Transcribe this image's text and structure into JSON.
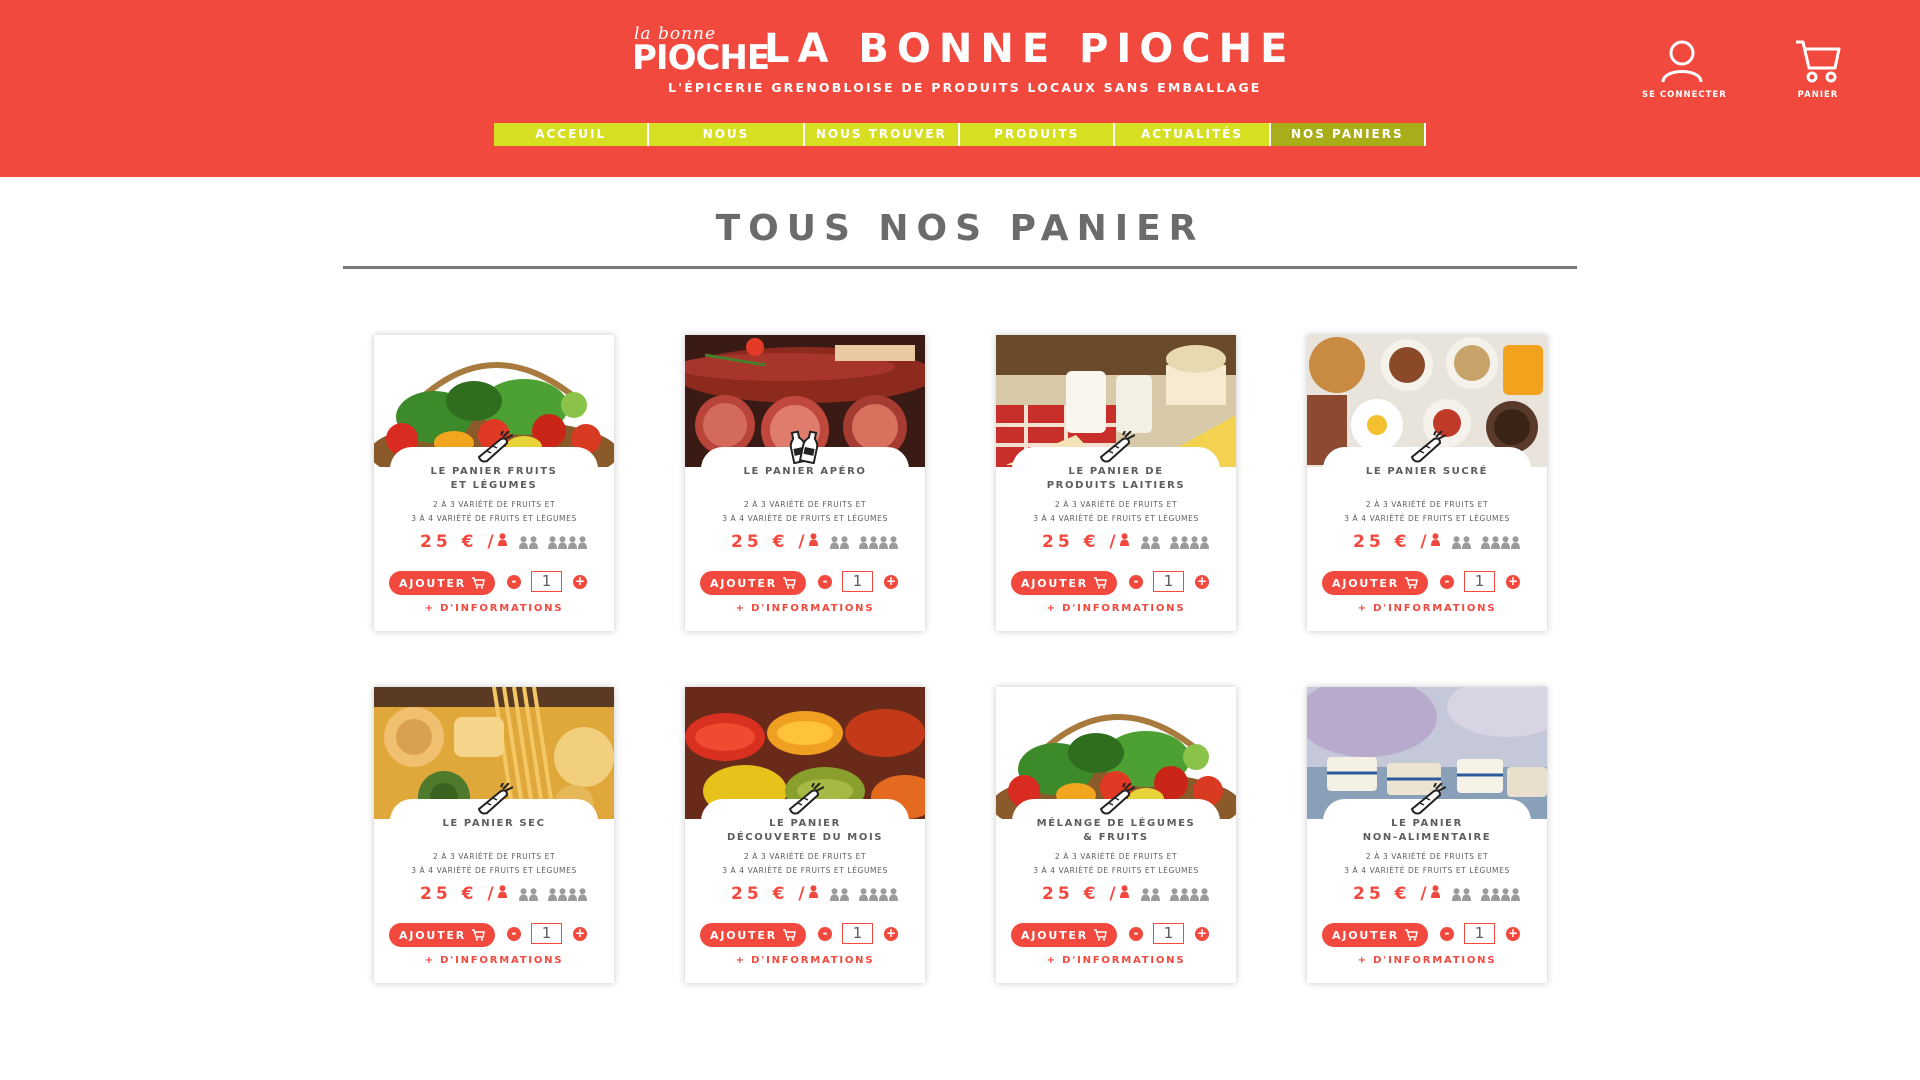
{
  "header": {
    "logo_small": "la bonne",
    "logo_big": "PIOCHE",
    "title": "LA BONNE PIOCHE",
    "subtitle": "L'ÉPICERIE GRENOBLOISE DE PRODUITS LOCAUX SANS EMBALLAGE",
    "login_label": "SE CONNECTER",
    "cart_label": "PANIER"
  },
  "nav": [
    "ACCEUIL",
    "NOUS",
    "NOUS TROUVER",
    "PRODUITS",
    "ACTUALITÉS",
    "NOS PANIERS"
  ],
  "nav_active": "NOS PANIERS",
  "main": {
    "title": "TOUS NOS PANIER"
  },
  "colors": {
    "brand_red": "#f2493f",
    "nav_green": "#d7df23",
    "nav_active": "#a8ae1a"
  },
  "products": [
    {
      "name_line1": "LE PANIER FRUITS",
      "name_line2": "ET LÉGUMES",
      "badge_icon": "carrot-icon",
      "image": "vegetable-basket"
    },
    {
      "name_line1": "LE PANIER APÉRO",
      "name_line2": "",
      "badge_icon": "bottles-icon",
      "image": "charcuterie"
    },
    {
      "name_line1": "LE PANIER DE",
      "name_line2": "PRODUITS LAITIERS",
      "badge_icon": "carrot-icon",
      "image": "dairy"
    },
    {
      "name_line1": "LE PANIER SUCRÉ",
      "name_line2": "",
      "badge_icon": "carrot-icon",
      "image": "breakfast"
    },
    {
      "name_line1": "LE PANIER SEC",
      "name_line2": "",
      "badge_icon": "carrot-icon",
      "image": "pasta"
    },
    {
      "name_line1": "LE PANIER",
      "name_line2": "DÉCOUVERTE DU MOIS",
      "badge_icon": "carrot-icon",
      "image": "spices"
    },
    {
      "name_line1": "MÉLANGE DE LÉGUMES",
      "name_line2": "& FRUITS",
      "badge_icon": "carrot-icon",
      "image": "vegetable-basket"
    },
    {
      "name_line1": "LE PANIER",
      "name_line2": "NON-ALIMENTAIRE",
      "badge_icon": "carrot-icon",
      "image": "soaps"
    }
  ],
  "card_common": {
    "desc_line1": "2 À 3 VARIÉTÉ DE FRUITS ET",
    "desc_line2": "3 À 4 VARIÉTÉ DE FRUITS ET LÉGUMES",
    "price": "25 € /",
    "add_label": "AJOUTER",
    "qty_minus": "-",
    "qty_plus": "+",
    "qty_value": "1",
    "more_label": "+ D'INFORMATIONS"
  }
}
